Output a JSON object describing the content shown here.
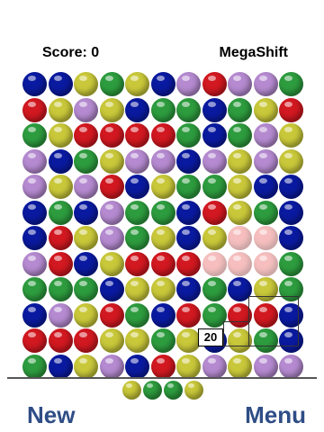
{
  "header": {
    "score_label": "Score: 0",
    "title": "MegaShift"
  },
  "selection_points": "20",
  "footer": {
    "new_label": "New",
    "menu_label": "Menu"
  },
  "colors": {
    "blue": "#0a1aa0",
    "red": "#d21820",
    "yellow": "#c9c83a",
    "green": "#2d9c3e",
    "purple": "#b58ad0",
    "pink": "#f08a8a"
  },
  "board": [
    [
      "blue",
      "blue",
      "yellow",
      "green",
      "yellow",
      "blue",
      "purple",
      "red",
      "purple",
      "purple",
      "green"
    ],
    [
      "red",
      "yellow",
      "purple",
      "yellow",
      "blue",
      "green",
      "green",
      "blue",
      "green",
      "yellow",
      "red"
    ],
    [
      "green",
      "yellow",
      "red",
      "red",
      "red",
      "red",
      "green",
      "blue",
      "green",
      "purple",
      "yellow"
    ],
    [
      "purple",
      "blue",
      "green",
      "yellow",
      "purple",
      "purple",
      "blue",
      "purple",
      "yellow",
      "purple",
      "yellow"
    ],
    [
      "purple",
      "yellow",
      "purple",
      "red",
      "blue",
      "yellow",
      "green",
      "green",
      "yellow",
      "blue",
      "blue"
    ],
    [
      "blue",
      "green",
      "blue",
      "purple",
      "green",
      "green",
      "blue",
      "red",
      "yellow",
      "green",
      "blue"
    ],
    [
      "blue",
      "red",
      "yellow",
      "purple",
      "green",
      "yellow",
      "blue",
      "yellow",
      "pink",
      "pink",
      "blue"
    ],
    [
      "purple",
      "red",
      "blue",
      "yellow",
      "red",
      "red",
      "red",
      "pink",
      "pink",
      "pink",
      "green"
    ],
    [
      "green",
      "green",
      "green",
      "blue",
      "yellow",
      "yellow",
      "blue",
      "green",
      "blue",
      "yellow",
      "green"
    ],
    [
      "blue",
      "purple",
      "yellow",
      "red",
      "green",
      "blue",
      "red",
      "green",
      "red",
      "red",
      "blue"
    ],
    [
      "red",
      "red",
      "red",
      "yellow",
      "yellow",
      "green",
      "yellow",
      "blue",
      "yellow",
      "green",
      "blue"
    ],
    [
      "green",
      "blue",
      "yellow",
      "purple",
      "blue",
      "red",
      "yellow",
      "purple",
      "yellow",
      "purple",
      "purple"
    ]
  ],
  "next_balls": [
    "yellow",
    "green",
    "green",
    "yellow"
  ]
}
